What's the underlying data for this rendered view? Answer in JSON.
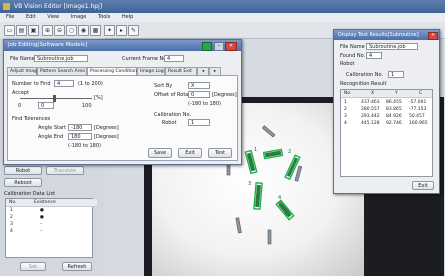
{
  "main_window": {
    "title": "VB Vision Editor [Image1.hpj]",
    "menu": [
      "File",
      "Edit",
      "View",
      "Image",
      "Tools",
      "Help"
    ]
  },
  "left_panel": {
    "btn_a": "Robot",
    "btn_b": "Translate",
    "btn_c": "Reboot",
    "calib_group_label": "Calibration Data List",
    "calib_headers": [
      "No.",
      "Existence"
    ],
    "calib_rows": [
      [
        "1",
        "●"
      ],
      [
        "2",
        "●"
      ],
      [
        "3",
        "–"
      ],
      [
        "4",
        "–"
      ]
    ],
    "btn_set": "Set",
    "btn_refresh": "Refresh"
  },
  "dialog": {
    "title": "Job Editing[Software Models]",
    "file_name_label": "File Name",
    "file_name_value": "Subroutine.job",
    "current_frame_label": "Current Frame No.",
    "current_frame_value": "4",
    "tabs": [
      "Adjust Image",
      "Pattern Search Area",
      "Processing Condition",
      "Image Log",
      "Result Exit"
    ],
    "number_to_find_label": "Number to Find",
    "number_to_find_value": "4",
    "number_to_find_range": "(1 to 200)",
    "accept_label": "Accept",
    "accept_min": "0",
    "accept_max": "100",
    "accept_value": "0",
    "accept_unit": "[%]",
    "tolerances_label": "Find Tolerances",
    "angle_start_label": "Angle Start",
    "angle_start_value": "-180",
    "angle_end_label": "Angle End",
    "angle_end_value": "180",
    "angle_unit": "[Degrees]",
    "angle_range": "(-180 to 180)",
    "sort_by_label": "Sort By",
    "sort_by_value": "X",
    "offset_rotation_label": "Offset of Rotation",
    "offset_rotation_value": "0",
    "offset_rotation_unit": "[Degrees]",
    "offset_rotation_range": "(-180 to 180)",
    "calib_no_label": "Calibration No.",
    "robot_label": "Robot",
    "robot_value": "1",
    "btn_save": "Save",
    "btn_exit": "Exit",
    "btn_test": "Test"
  },
  "right_window": {
    "title": "Display Test Results[Subroutine]",
    "file_name_label": "File Name",
    "file_name_value": "Subroutine.job",
    "found_no_label": "Found No.",
    "found_no_value": "4",
    "robot_label": "Robot",
    "calib_no_label": "Calibration No.",
    "calib_no_value": "1",
    "result_label": "Recognition Result",
    "headers": [
      "No.",
      "X",
      "Y",
      "C"
    ],
    "rows": [
      [
        "1",
        "437.463",
        "86.455",
        "-57.001"
      ],
      [
        "2",
        "280.557",
        "83.865",
        "-77.153"
      ],
      [
        "3",
        "293.442",
        "84.926",
        "50.457"
      ],
      [
        "4",
        "445.128",
        "92.746",
        "160.965"
      ]
    ],
    "btn_exit": "Exit"
  },
  "workpiece_labels": [
    "1",
    "2",
    "3",
    "4"
  ],
  "colors": {
    "title_bar": "#4c6fa8",
    "match_box": "#1fb24a"
  }
}
